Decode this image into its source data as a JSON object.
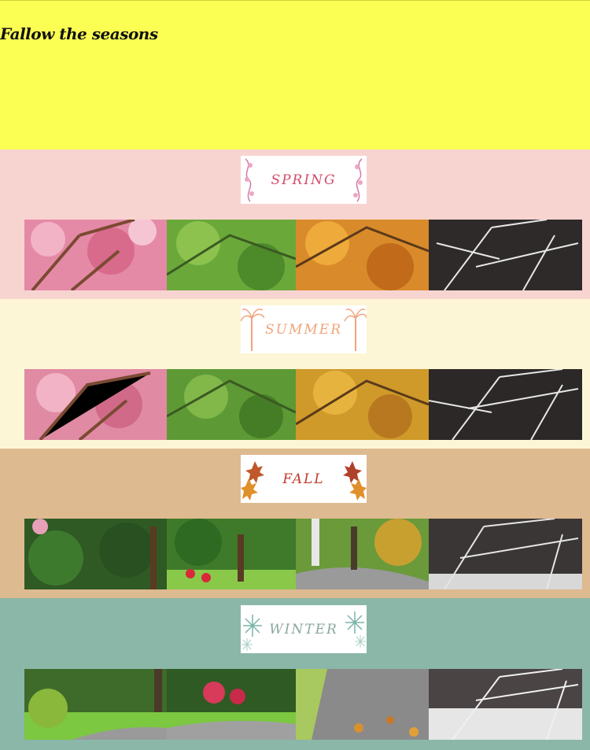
{
  "header": {
    "title": "Fallow the seasons",
    "background": "#fbff54"
  },
  "seasons": [
    {
      "label": "SPRING",
      "background": "#f8d4d1",
      "label_color": "#d24a6a",
      "decoration_icon": "floral-vine-icon",
      "panels": [
        "cherry-blossom",
        "green-leaves",
        "orange-leaves",
        "bare-snowy-branches"
      ]
    },
    {
      "label": "SUMMER",
      "background": "#fcf6d6",
      "label_color": "#f0a47a",
      "decoration_icon": "palm-tree-icon",
      "panels": [
        "cherry-blossom",
        "green-leaves",
        "orange-leaves",
        "bare-snowy-branches"
      ]
    },
    {
      "label": "FALL",
      "background": "#deba90",
      "label_color": "#c0392b",
      "decoration_icon": "maple-leaf-icon",
      "panels": [
        "garden-spring",
        "garden-summer",
        "garden-fall",
        "garden-winter"
      ]
    },
    {
      "label": "WINTER",
      "background": "#8bb7a9",
      "label_color": "#8aa7a0",
      "decoration_icon": "snowflake-icon",
      "panels": [
        "park-path-spring",
        "park-path-summer",
        "park-path-fall",
        "park-path-winter"
      ]
    }
  ]
}
